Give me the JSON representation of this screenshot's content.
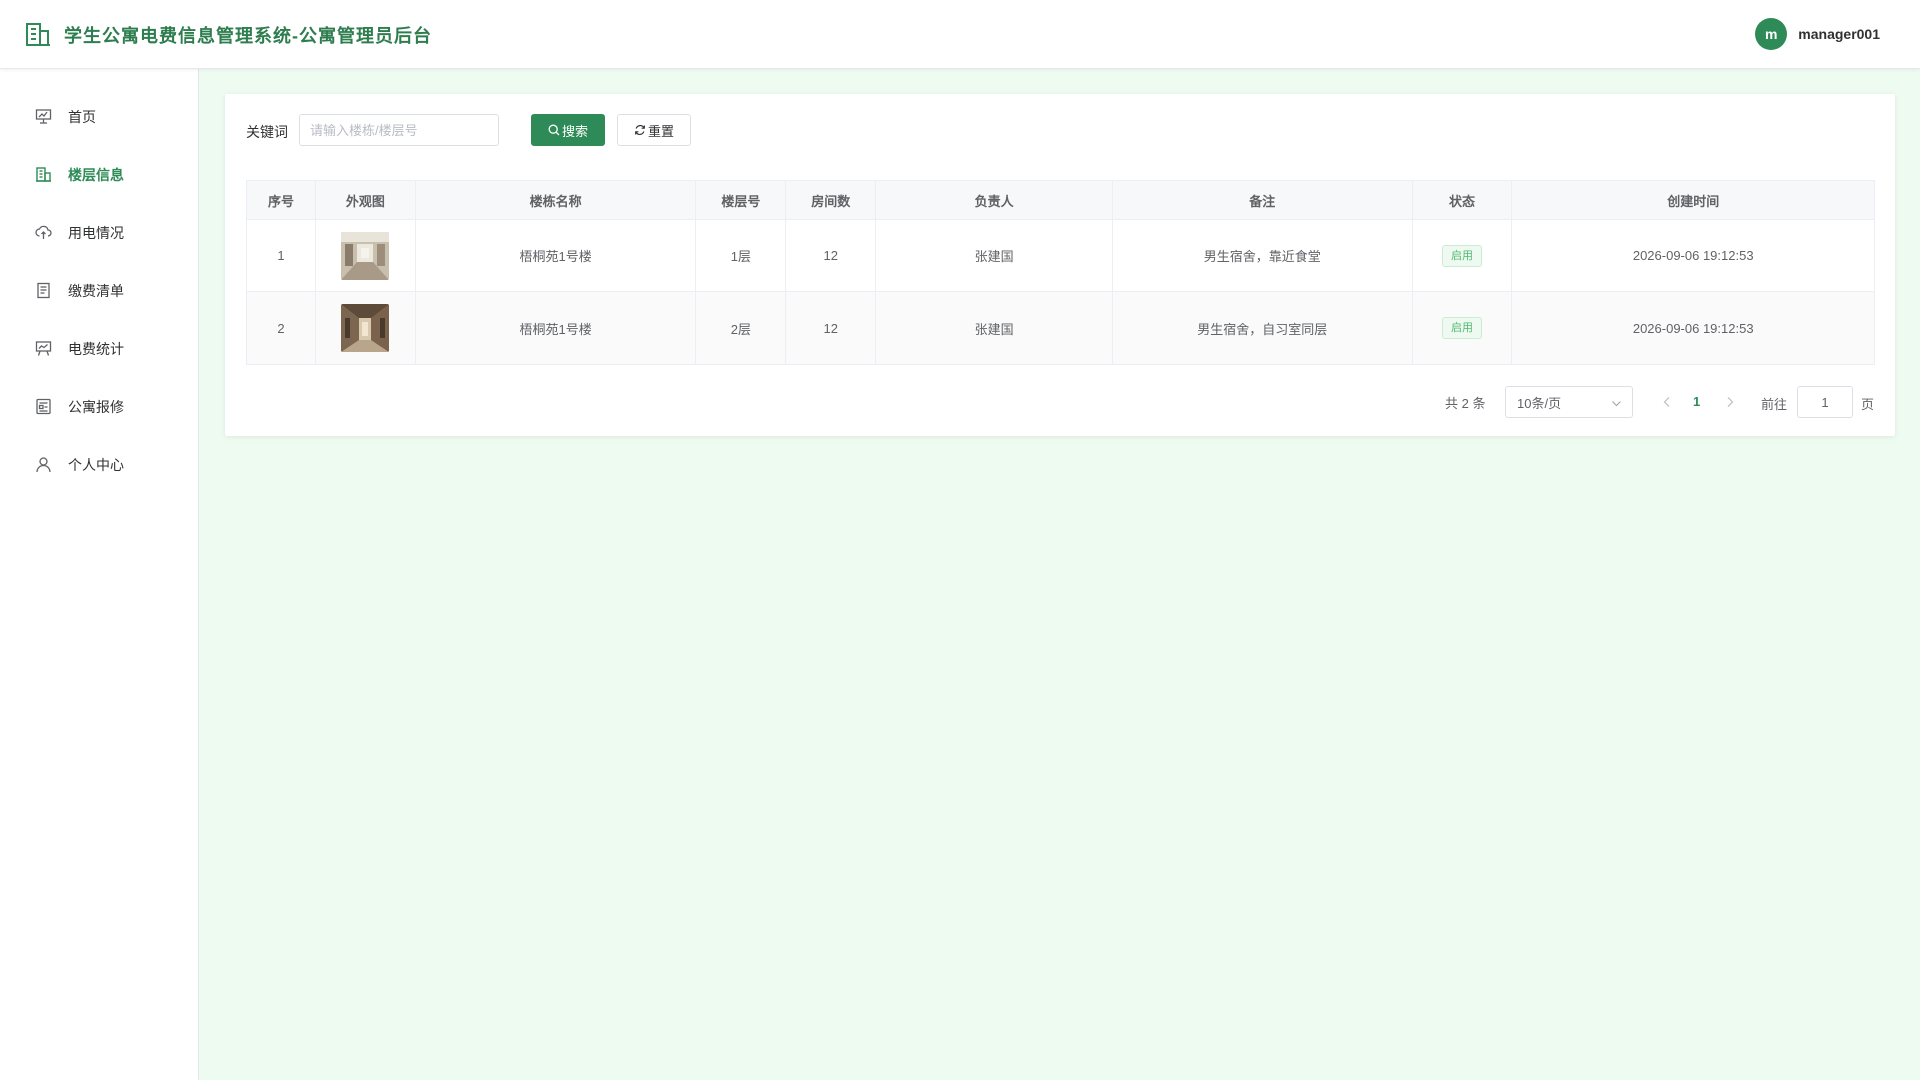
{
  "header": {
    "title": "学生公寓电费信息管理系统-公寓管理员后台",
    "avatar_letter": "m",
    "username": "manager001"
  },
  "sidebar": {
    "items": [
      {
        "label": "首页",
        "icon": "presentation-icon",
        "active": false
      },
      {
        "label": "楼层信息",
        "icon": "building-icon",
        "active": true
      },
      {
        "label": "用电情况",
        "icon": "cloud-upload-icon",
        "active": false
      },
      {
        "label": "缴费清单",
        "icon": "document-icon",
        "active": false
      },
      {
        "label": "电费统计",
        "icon": "stats-board-icon",
        "active": false
      },
      {
        "label": "公寓报修",
        "icon": "repair-form-icon",
        "active": false
      },
      {
        "label": "个人中心",
        "icon": "user-icon",
        "active": false
      }
    ]
  },
  "search": {
    "label": "关键词",
    "placeholder": "请输入楼栋/楼层号",
    "value": "",
    "search_button": "搜索",
    "reset_button": "重置"
  },
  "table": {
    "columns": [
      "序号",
      "外观图",
      "楼栋名称",
      "楼层号",
      "房间数",
      "负责人",
      "备注",
      "状态",
      "创建时间"
    ],
    "rows": [
      {
        "index": "1",
        "image": "corridor-photo-1",
        "building": "梧桐苑1号楼",
        "floor": "1层",
        "rooms": "12",
        "manager": "张建国",
        "remark": "男生宿舍，靠近食堂",
        "status": "启用",
        "created": "2026-09-06 19:12:53"
      },
      {
        "index": "2",
        "image": "corridor-photo-2",
        "building": "梧桐苑1号楼",
        "floor": "2层",
        "rooms": "12",
        "manager": "张建国",
        "remark": "男生宿舍，自习室同层",
        "status": "启用",
        "created": "2026-09-06 19:12:53"
      }
    ]
  },
  "pagination": {
    "total": "共 2 条",
    "page_size": "10条/页",
    "current_page": "1",
    "goto_label": "前往",
    "goto_value": "1",
    "goto_unit": "页"
  },
  "colors": {
    "accent": "#2e8b57",
    "title_green": "#2e7d4f",
    "main_bg": "#eefbf1",
    "tag_text": "#52b96f"
  }
}
